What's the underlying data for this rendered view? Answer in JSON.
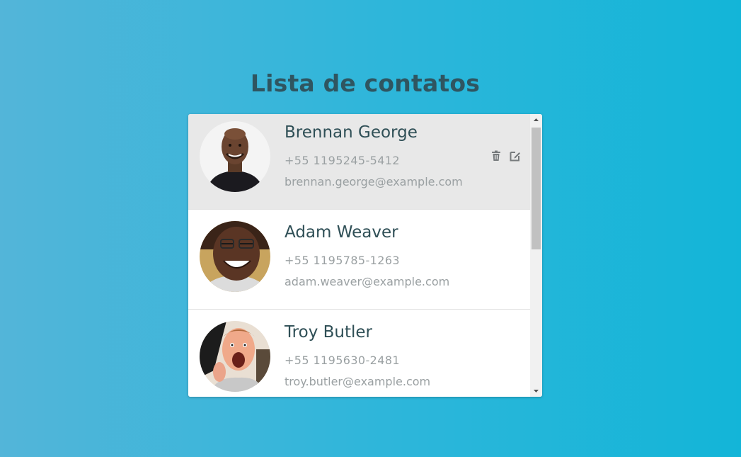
{
  "page": {
    "title": "Lista de contatos"
  },
  "contacts": [
    {
      "name": "Brennan George",
      "phone": "+55 1195245-5412",
      "email": "brennan.george@example.com",
      "hovered": true,
      "actions": [
        "trash-icon",
        "edit-icon"
      ]
    },
    {
      "name": "Adam Weaver",
      "phone": "+55 1195785-1263",
      "email": "adam.weaver@example.com",
      "hovered": false
    },
    {
      "name": "Troy Butler",
      "phone": "+55 1195630-2481",
      "email": "troy.butler@example.com",
      "hovered": false
    }
  ],
  "colors": {
    "title": "#2f5560",
    "name": "#2f4f56",
    "secondary_text": "#9aa0a2",
    "hover_row": "#e8e8e8",
    "background_left": "#53b5d9",
    "background_right": "#13b5d8"
  }
}
